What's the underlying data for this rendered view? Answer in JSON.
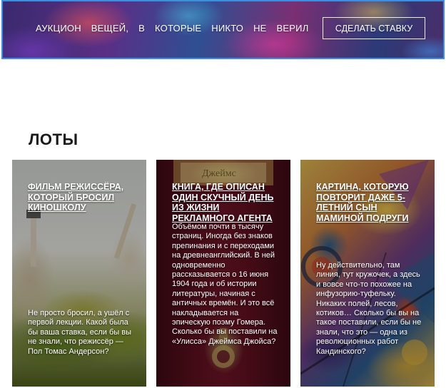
{
  "hero": {
    "title_words": [
      "АУКЦИОН",
      "ВЕЩЕЙ,",
      "В",
      "КОТОРЫЕ",
      "НИКТО",
      "НЕ",
      "ВЕРИЛ"
    ],
    "bid_button_label": "СДЕЛАТЬ СТАВКУ"
  },
  "lots": {
    "section_title": "ЛОТЫ",
    "cards": [
      {
        "title": "ФИЛЬМ РЕЖИССЁРА, КОТОРЫЙ БРОСИЛ КИНОШКОЛУ",
        "description": "Не просто бросил, а ушёл с первой лекции. Какой была бы ваша ставка, если бы вы не знали, что режиссёр — Пол Томас Андерсон?"
      },
      {
        "title": "КНИГА, ГДЕ ОПИСАН ОДИН СКУЧНЫЙ ДЕНЬ ИЗ ЖИЗНИ РЕКЛАМНОГО АГЕНТА",
        "description": "Объёмом почти в тысячу страниц. Иногда без знаков препинания и с переходами на древнеанглийский. В ней одновременно рассказывается о 16 июня 1904 года и об истории литературы, начиная с античных времён. И это всё накладывается на эпическую поэму Гомера. Сколько бы вы поставили на «Улисса» Джеймса Джойса?",
        "cover_text": "Джеймс"
      },
      {
        "title": "КАРТИНА, КОТОРУЮ ПОВТОРИТ ДАЖЕ 5-ЛЕТНИЙ СЫН МАМИНОЙ ПОДРУГИ",
        "description": "Ну действительно, там линия, тут кружочек, а здесь и вовсе что-то похожее на инфузорию-туфельку. Никаких полей, лесов, котиков… Сколько бы вы на такое поставили, если бы не знали, что это — одна из революционных работ Кандинского?"
      }
    ]
  }
}
